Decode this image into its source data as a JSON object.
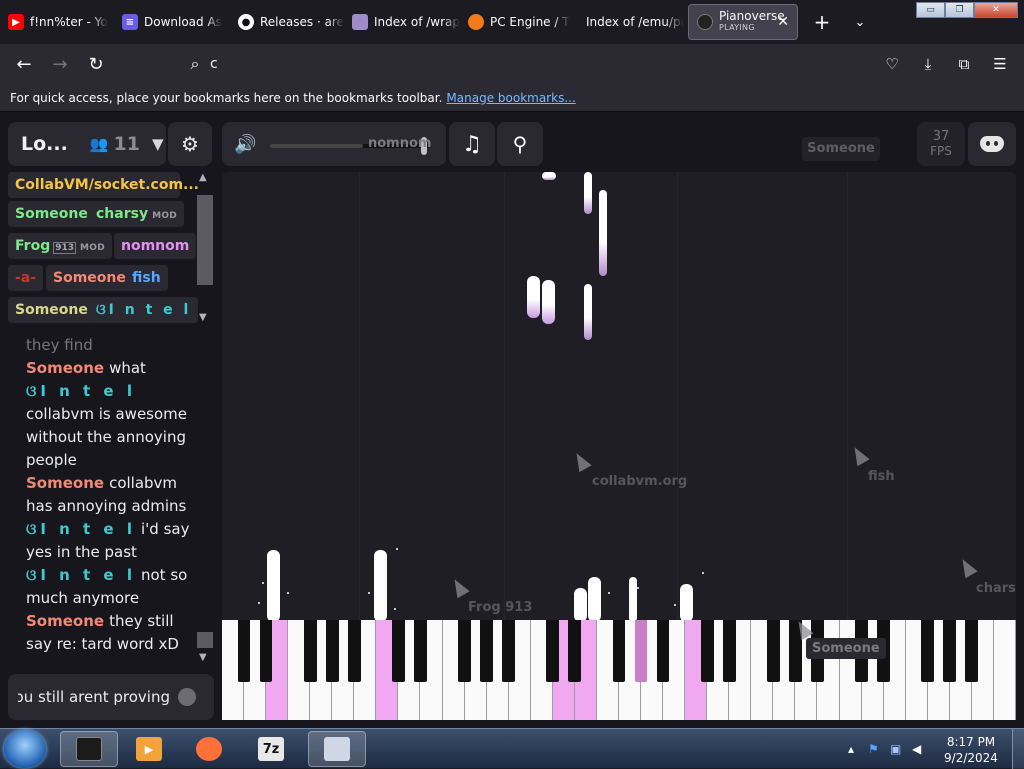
{
  "browser": {
    "tabs": [
      {
        "title": "f!nn%ter - Yo",
        "icon": "youtube-icon",
        "color": "#ff0000"
      },
      {
        "title": "Download As",
        "icon": "download-site-icon",
        "color": "#6b5ce7"
      },
      {
        "title": "Releases · arer",
        "icon": "github-icon",
        "color": "#ffffff"
      },
      {
        "title": "Index of /wrap",
        "icon": "folder-icon",
        "color": "#9f8cc9"
      },
      {
        "title": "PC Engine / T",
        "icon": "pcengine-icon",
        "color": "#f27a1a"
      },
      {
        "title": "Index of /emu/pc",
        "icon": "none",
        "color": ""
      }
    ],
    "active_tab": {
      "title": "Pianoverse",
      "status": "PLAYING",
      "close": "✕"
    },
    "new_tab": "+",
    "tab_list": "⌄",
    "window_buttons": {
      "minimize": "▭",
      "restore": "❐",
      "close": "✕"
    },
    "nav": {
      "back": "←",
      "forward": "→",
      "reload": "↻"
    },
    "url": "c",
    "search_glyph": "⌕",
    "toolbar_icons": {
      "pocket": "♡",
      "downloads": "⤓",
      "extensions": "⧉",
      "menu": "☰"
    },
    "bookmarks_bar": {
      "message": "For quick access, place your bookmarks here on the bookmarks toolbar.",
      "link": "Manage bookmarks..."
    }
  },
  "app": {
    "room": {
      "name": "Lo...",
      "user_count": "11",
      "people_glyph": "👥",
      "caret": "▼"
    },
    "settings_glyph": "⚙",
    "volume": {
      "glyph": "🔊",
      "level": 0.58,
      "ghost_label": "nomnom"
    },
    "music_glyph": "♫",
    "usb_glyph": "⚲",
    "fps": {
      "value": "37",
      "unit": "FPS"
    },
    "someone_tag": "Someone",
    "users": [
      {
        "name": "CollabVM/socket.com...",
        "color": "#f5c542"
      },
      {
        "name": "Someone",
        "color": "#7ee88a"
      },
      {
        "name": "charsy",
        "color": "#7ee88a",
        "badge": "MOD"
      },
      {
        "name": "Frog",
        "color": "#7ee88a",
        "flag": "913",
        "badge": "MOD"
      },
      {
        "name": "nomnom",
        "color": "#e58ff0"
      },
      {
        "name": "-a-",
        "color": "#c0392b"
      },
      {
        "name": "Someone",
        "color": "#f08a76"
      },
      {
        "name": "fish",
        "color": "#58a6ff"
      },
      {
        "name": "Someone",
        "color": "#d7d88a"
      },
      {
        "name": "ଓI n t e l",
        "color": "#3ec9d1"
      }
    ],
    "chat": [
      {
        "text": "they find"
      },
      {
        "user": "Someone",
        "color": "#f08a76",
        "text": "what"
      },
      {
        "user": "ଓI n t e l",
        "color": "#3ec9d1",
        "text": "collabvm is awesome without the annoying people"
      },
      {
        "user": "Someone",
        "color": "#f08a76",
        "text": "collabvm has annoying admins"
      },
      {
        "user": "ଓI n t e l",
        "color": "#3ec9d1",
        "text": "i'd say yes in the past"
      },
      {
        "user": "ଓI n t e l",
        "color": "#3ec9d1",
        "text": "not so much anymore"
      },
      {
        "user": "Someone",
        "color": "#f08a76",
        "text": "they still say re: tard word xD"
      }
    ],
    "chat_input": "ou still arent proving",
    "cursor_labels": [
      {
        "name": "nomnom"
      },
      {
        "name": "collabvm.org"
      },
      {
        "name": "fish"
      },
      {
        "name": "Frog 913"
      },
      {
        "name": "charsy"
      },
      {
        "name": "Someone"
      }
    ]
  },
  "taskbar": {
    "apps": [
      {
        "name": "terminal",
        "icon": "terminal-icon",
        "color": "#1b1b1b"
      },
      {
        "name": "media",
        "icon": "media-player-icon",
        "color": "#f2a33a"
      },
      {
        "name": "firefox",
        "icon": "firefox-icon",
        "color": "#ff7139"
      },
      {
        "name": "7z",
        "icon": "7zip-icon",
        "color": "#e8e8e8",
        "label": "7z"
      },
      {
        "name": "emulator",
        "icon": "emulator-icon",
        "color": "#cfd7e6"
      }
    ],
    "clock": {
      "time": "8:17 PM",
      "date": "9/2/2024"
    },
    "tray_glyphs": {
      "chevron": "▴",
      "flag": "⚑",
      "network": "▣",
      "volume": "◀"
    }
  }
}
